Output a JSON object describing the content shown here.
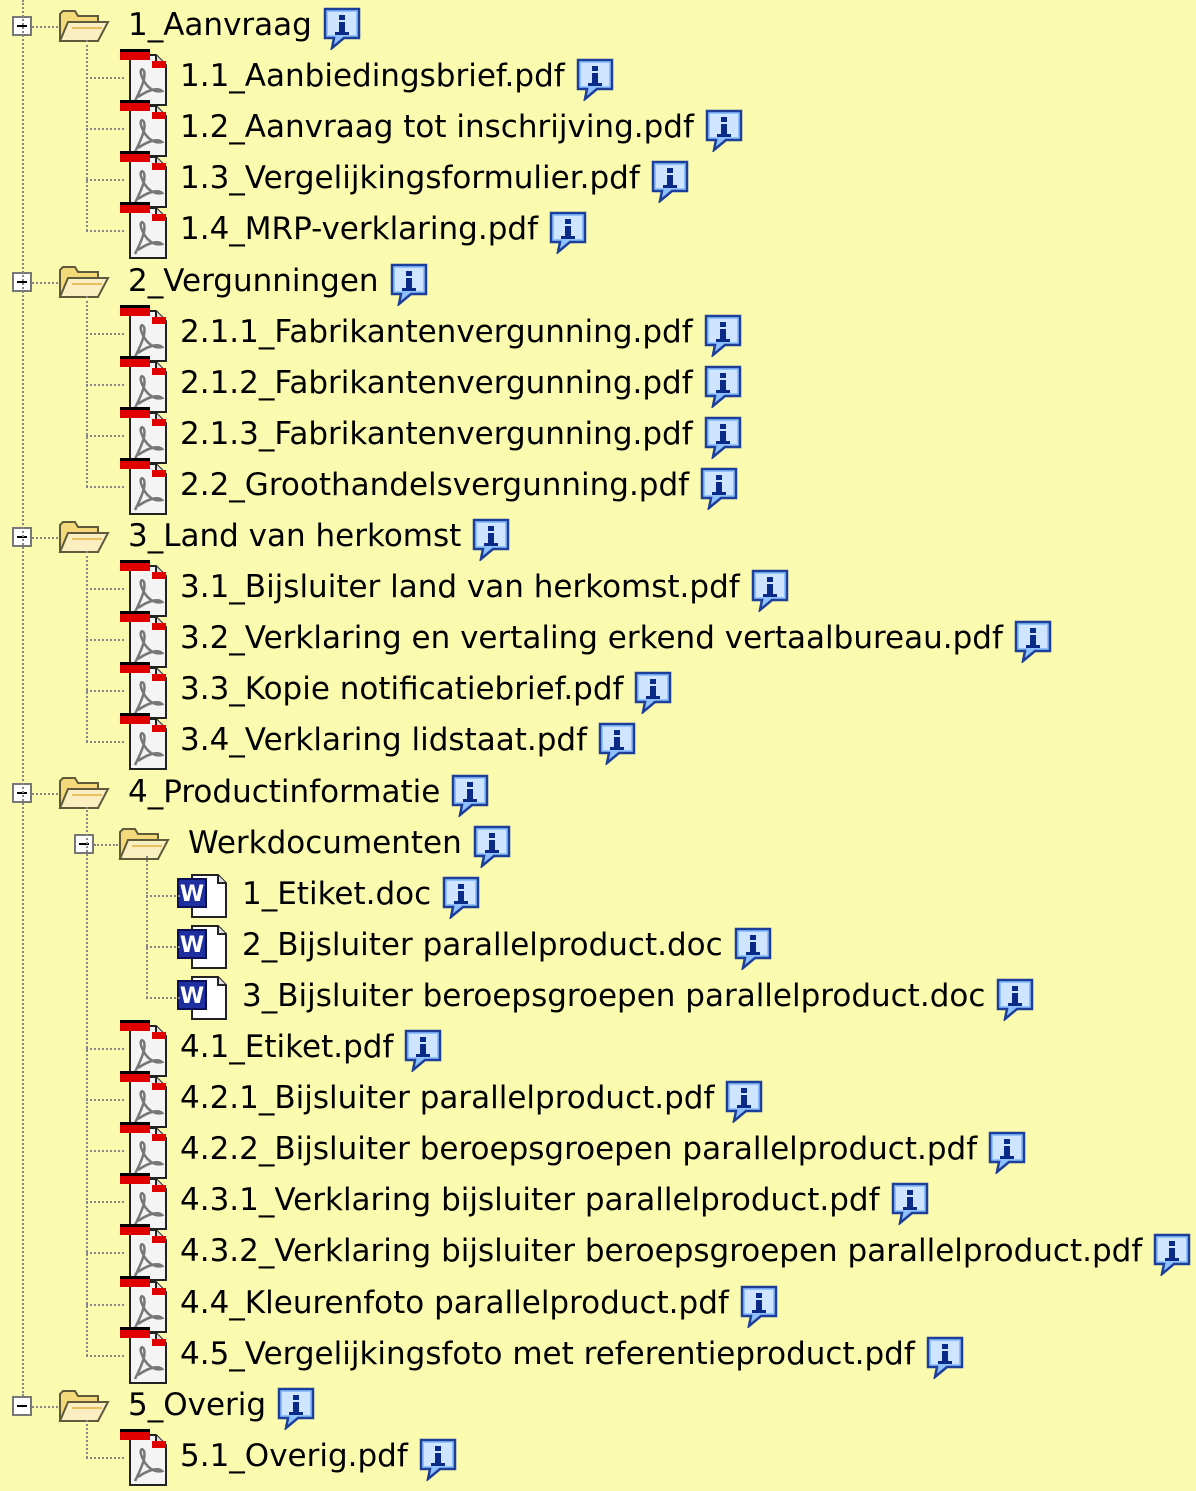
{
  "tree": {
    "folders": [
      {
        "label": "1_Aanvraag",
        "files": [
          {
            "label": "1.1_Aanbiedingsbrief.pdf",
            "type": "pdf"
          },
          {
            "label": "1.2_Aanvraag tot inschrijving.pdf",
            "type": "pdf"
          },
          {
            "label": "1.3_Vergelijkingsformulier.pdf",
            "type": "pdf"
          },
          {
            "label": "1.4_MRP-verklaring.pdf",
            "type": "pdf"
          }
        ]
      },
      {
        "label": "2_Vergunningen",
        "files": [
          {
            "label": "2.1.1_Fabrikantenvergunning.pdf",
            "type": "pdf"
          },
          {
            "label": "2.1.2_Fabrikantenvergunning.pdf",
            "type": "pdf"
          },
          {
            "label": "2.1.3_Fabrikantenvergunning.pdf",
            "type": "pdf"
          },
          {
            "label": "2.2_Groothandelsvergunning.pdf",
            "type": "pdf"
          }
        ]
      },
      {
        "label": "3_Land van herkomst",
        "files": [
          {
            "label": "3.1_Bijsluiter land van herkomst.pdf",
            "type": "pdf"
          },
          {
            "label": "3.2_Verklaring en vertaling erkend vertaalbureau.pdf",
            "type": "pdf"
          },
          {
            "label": "3.3_Kopie notificatiebrief.pdf",
            "type": "pdf"
          },
          {
            "label": "3.4_Verklaring lidstaat.pdf",
            "type": "pdf"
          }
        ]
      },
      {
        "label": "4_Productinformatie",
        "subfolder": {
          "label": "Werkdocumenten",
          "files": [
            {
              "label": "1_Etiket.doc",
              "type": "doc"
            },
            {
              "label": "2_Bijsluiter parallelproduct.doc",
              "type": "doc"
            },
            {
              "label": "3_Bijsluiter beroepsgroepen parallelproduct.doc",
              "type": "doc"
            }
          ]
        },
        "files": [
          {
            "label": "4.1_Etiket.pdf",
            "type": "pdf"
          },
          {
            "label": "4.2.1_Bijsluiter parallelproduct.pdf",
            "type": "pdf"
          },
          {
            "label": "4.2.2_Bijsluiter beroepsgroepen parallelproduct.pdf",
            "type": "pdf"
          },
          {
            "label": "4.3.1_Verklaring bijsluiter parallelproduct.pdf",
            "type": "pdf"
          },
          {
            "label": "4.3.2_Verklaring bijsluiter beroepsgroepen parallelproduct.pdf",
            "type": "pdf"
          },
          {
            "label": "4.4_Kleurenfoto parallelproduct.pdf",
            "type": "pdf"
          },
          {
            "label": "4.5_Vergelijkingsfoto met referentieproduct.pdf",
            "type": "pdf"
          }
        ]
      },
      {
        "label": "5_Overig",
        "files": [
          {
            "label": "5.1_Overig.pdf",
            "type": "pdf"
          }
        ]
      }
    ]
  },
  "icons": {
    "folder": "folder-open-icon",
    "pdf": "pdf-file-icon",
    "doc": "word-document-icon",
    "info": "info-icon",
    "toggle": "collapse-toggle-icon"
  },
  "colors": {
    "background": "#fbfbb0",
    "folder": "#f7e39a",
    "pdf_red": "#e00000",
    "word_blue": "#1f2fa0",
    "info_blue": "#3c6fd6"
  }
}
